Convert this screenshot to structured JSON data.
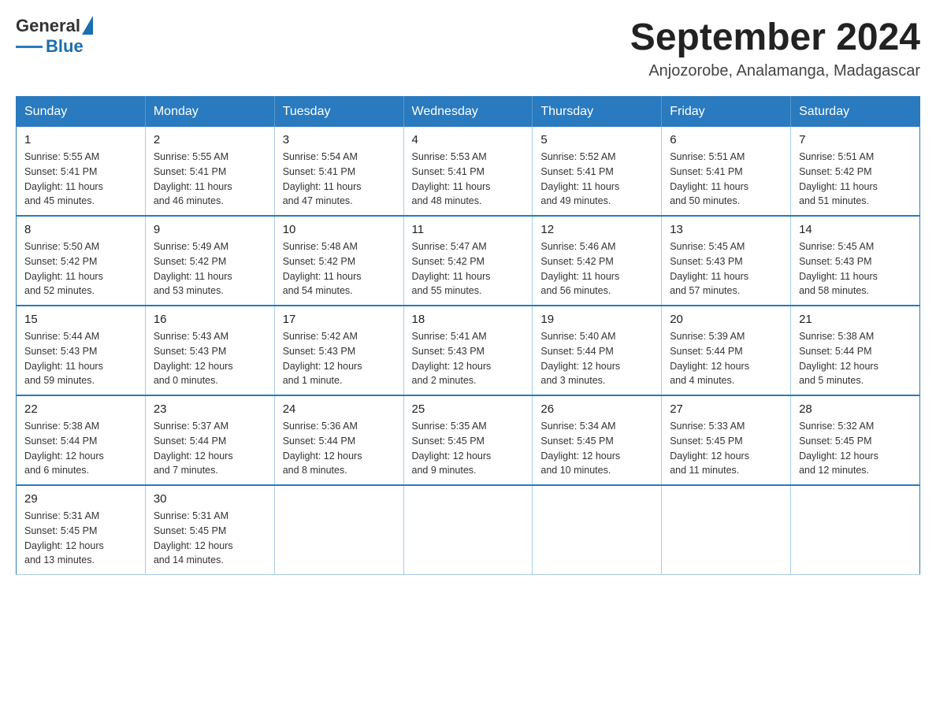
{
  "logo": {
    "text_general": "General",
    "text_blue": "Blue",
    "triangle_unicode": "▲"
  },
  "title": "September 2024",
  "subtitle": "Anjozorobe, Analamanga, Madagascar",
  "days_header": [
    "Sunday",
    "Monday",
    "Tuesday",
    "Wednesday",
    "Thursday",
    "Friday",
    "Saturday"
  ],
  "weeks": [
    [
      {
        "day": "1",
        "info": "Sunrise: 5:55 AM\nSunset: 5:41 PM\nDaylight: 11 hours\nand 45 minutes."
      },
      {
        "day": "2",
        "info": "Sunrise: 5:55 AM\nSunset: 5:41 PM\nDaylight: 11 hours\nand 46 minutes."
      },
      {
        "day": "3",
        "info": "Sunrise: 5:54 AM\nSunset: 5:41 PM\nDaylight: 11 hours\nand 47 minutes."
      },
      {
        "day": "4",
        "info": "Sunrise: 5:53 AM\nSunset: 5:41 PM\nDaylight: 11 hours\nand 48 minutes."
      },
      {
        "day": "5",
        "info": "Sunrise: 5:52 AM\nSunset: 5:41 PM\nDaylight: 11 hours\nand 49 minutes."
      },
      {
        "day": "6",
        "info": "Sunrise: 5:51 AM\nSunset: 5:41 PM\nDaylight: 11 hours\nand 50 minutes."
      },
      {
        "day": "7",
        "info": "Sunrise: 5:51 AM\nSunset: 5:42 PM\nDaylight: 11 hours\nand 51 minutes."
      }
    ],
    [
      {
        "day": "8",
        "info": "Sunrise: 5:50 AM\nSunset: 5:42 PM\nDaylight: 11 hours\nand 52 minutes."
      },
      {
        "day": "9",
        "info": "Sunrise: 5:49 AM\nSunset: 5:42 PM\nDaylight: 11 hours\nand 53 minutes."
      },
      {
        "day": "10",
        "info": "Sunrise: 5:48 AM\nSunset: 5:42 PM\nDaylight: 11 hours\nand 54 minutes."
      },
      {
        "day": "11",
        "info": "Sunrise: 5:47 AM\nSunset: 5:42 PM\nDaylight: 11 hours\nand 55 minutes."
      },
      {
        "day": "12",
        "info": "Sunrise: 5:46 AM\nSunset: 5:42 PM\nDaylight: 11 hours\nand 56 minutes."
      },
      {
        "day": "13",
        "info": "Sunrise: 5:45 AM\nSunset: 5:43 PM\nDaylight: 11 hours\nand 57 minutes."
      },
      {
        "day": "14",
        "info": "Sunrise: 5:45 AM\nSunset: 5:43 PM\nDaylight: 11 hours\nand 58 minutes."
      }
    ],
    [
      {
        "day": "15",
        "info": "Sunrise: 5:44 AM\nSunset: 5:43 PM\nDaylight: 11 hours\nand 59 minutes."
      },
      {
        "day": "16",
        "info": "Sunrise: 5:43 AM\nSunset: 5:43 PM\nDaylight: 12 hours\nand 0 minutes."
      },
      {
        "day": "17",
        "info": "Sunrise: 5:42 AM\nSunset: 5:43 PM\nDaylight: 12 hours\nand 1 minute."
      },
      {
        "day": "18",
        "info": "Sunrise: 5:41 AM\nSunset: 5:43 PM\nDaylight: 12 hours\nand 2 minutes."
      },
      {
        "day": "19",
        "info": "Sunrise: 5:40 AM\nSunset: 5:44 PM\nDaylight: 12 hours\nand 3 minutes."
      },
      {
        "day": "20",
        "info": "Sunrise: 5:39 AM\nSunset: 5:44 PM\nDaylight: 12 hours\nand 4 minutes."
      },
      {
        "day": "21",
        "info": "Sunrise: 5:38 AM\nSunset: 5:44 PM\nDaylight: 12 hours\nand 5 minutes."
      }
    ],
    [
      {
        "day": "22",
        "info": "Sunrise: 5:38 AM\nSunset: 5:44 PM\nDaylight: 12 hours\nand 6 minutes."
      },
      {
        "day": "23",
        "info": "Sunrise: 5:37 AM\nSunset: 5:44 PM\nDaylight: 12 hours\nand 7 minutes."
      },
      {
        "day": "24",
        "info": "Sunrise: 5:36 AM\nSunset: 5:44 PM\nDaylight: 12 hours\nand 8 minutes."
      },
      {
        "day": "25",
        "info": "Sunrise: 5:35 AM\nSunset: 5:45 PM\nDaylight: 12 hours\nand 9 minutes."
      },
      {
        "day": "26",
        "info": "Sunrise: 5:34 AM\nSunset: 5:45 PM\nDaylight: 12 hours\nand 10 minutes."
      },
      {
        "day": "27",
        "info": "Sunrise: 5:33 AM\nSunset: 5:45 PM\nDaylight: 12 hours\nand 11 minutes."
      },
      {
        "day": "28",
        "info": "Sunrise: 5:32 AM\nSunset: 5:45 PM\nDaylight: 12 hours\nand 12 minutes."
      }
    ],
    [
      {
        "day": "29",
        "info": "Sunrise: 5:31 AM\nSunset: 5:45 PM\nDaylight: 12 hours\nand 13 minutes."
      },
      {
        "day": "30",
        "info": "Sunrise: 5:31 AM\nSunset: 5:45 PM\nDaylight: 12 hours\nand 14 minutes."
      },
      {
        "day": "",
        "info": ""
      },
      {
        "day": "",
        "info": ""
      },
      {
        "day": "",
        "info": ""
      },
      {
        "day": "",
        "info": ""
      },
      {
        "day": "",
        "info": ""
      }
    ]
  ]
}
